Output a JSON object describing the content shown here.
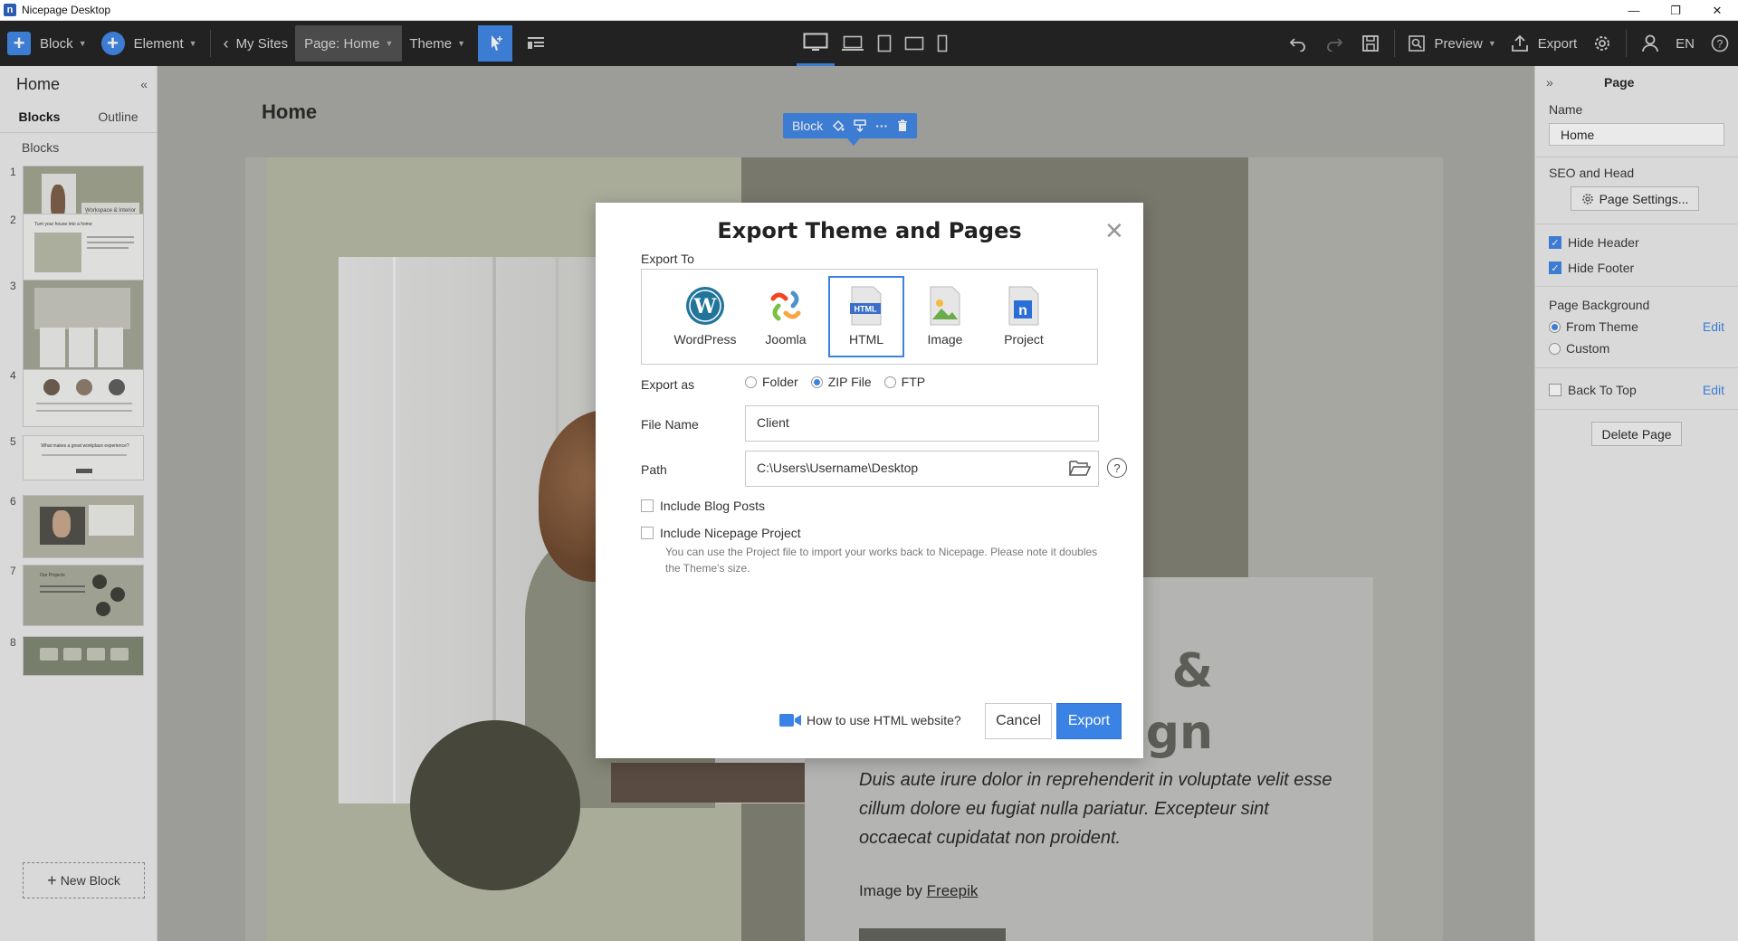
{
  "window": {
    "title": "Nicepage Desktop",
    "minimize": "—",
    "maximize": "❐",
    "close": "✕"
  },
  "toolbar": {
    "block_label": "Block",
    "element_label": "Element",
    "my_sites_label": "My Sites",
    "page_label": "Page: Home",
    "theme_label": "Theme",
    "preview_label": "Preview",
    "export_label": "Export",
    "language": "EN"
  },
  "left_panel": {
    "title": "Home",
    "tabs": [
      "Blocks",
      "Outline"
    ],
    "section_label": "Blocks",
    "thumbs": [
      {
        "num": "1",
        "caption": "Workspace & Interior Design"
      },
      {
        "num": "2",
        "caption": "Turn your house into a home"
      },
      {
        "num": "3",
        "caption": ""
      },
      {
        "num": "4",
        "caption": ""
      },
      {
        "num": "5",
        "caption": "What makes a great workplace experience?"
      },
      {
        "num": "6",
        "caption": ""
      },
      {
        "num": "7",
        "caption": "Our Projects"
      },
      {
        "num": "8",
        "caption": ""
      }
    ],
    "new_block_label": "New Block"
  },
  "canvas": {
    "page_title": "Home",
    "block_tag": "Block",
    "heading_partial": "&\nign",
    "body_text": "Duis aute irure dolor in reprehenderit in voluptate velit esse cillum dolore eu fugiat nulla pariatur. Excepteur sint occaecat cupidatat non proident.",
    "credit_prefix": "Image by ",
    "credit_link": "Freepik",
    "zoom_value": "100",
    "zoom_fraction": 0.4
  },
  "right_panel": {
    "title": "Page",
    "name_label": "Name",
    "name_value": "Home",
    "seo_label": "SEO and Head",
    "page_settings_label": "Page Settings...",
    "hide_header_label": "Hide Header",
    "hide_footer_label": "Hide Footer",
    "page_background_label": "Page Background",
    "from_theme_label": "From Theme",
    "custom_label": "Custom",
    "edit_label": "Edit",
    "back_to_top_label": "Back To Top",
    "delete_page_label": "Delete Page"
  },
  "modal": {
    "title": "Export Theme and Pages",
    "export_to_label": "Export To",
    "options": [
      "WordPress",
      "Joomla",
      "HTML",
      "Image",
      "Project"
    ],
    "selected_option": "HTML",
    "export_as_label": "Export as",
    "export_as_options": [
      "Folder",
      "ZIP File",
      "FTP"
    ],
    "export_as_selected": "ZIP File",
    "file_name_label": "File Name",
    "file_name_value": "Client",
    "path_label": "Path",
    "path_value": "C:\\Users\\Username\\Desktop",
    "include_blog_label": "Include Blog Posts",
    "include_project_label": "Include Nicepage Project",
    "project_note": "You can use the Project file to import your works back to Nicepage. Please note it doubles the Theme's size.",
    "howto_label": "How to use HTML website?",
    "cancel_label": "Cancel",
    "export_label": "Export"
  },
  "colors": {
    "accent": "#3b82e5",
    "toolbar_bg": "#1c1c1c",
    "panel_bg": "#ececec"
  }
}
